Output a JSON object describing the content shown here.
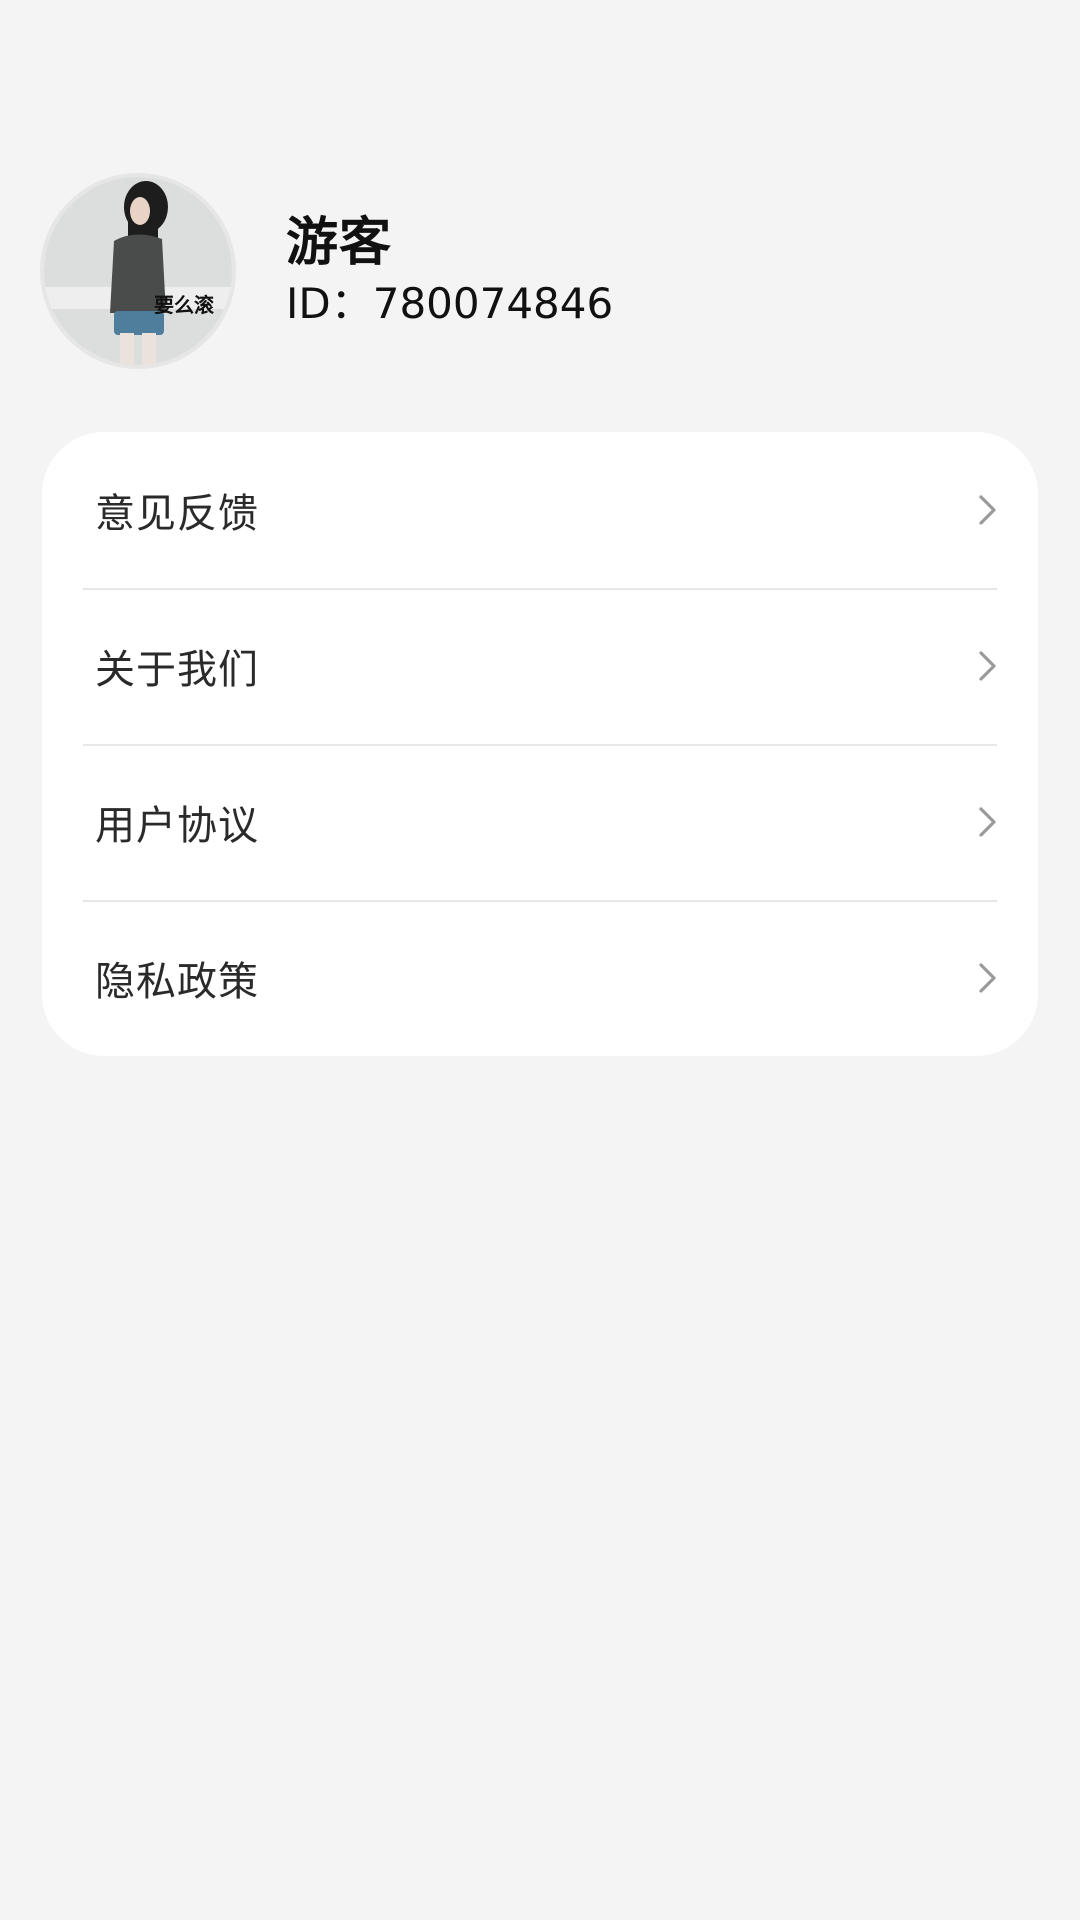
{
  "profile": {
    "avatar_caption": "要么滚",
    "username": "游客",
    "user_id": "ID：780074846"
  },
  "menu": {
    "items": [
      {
        "label": "意见反馈",
        "icon": "chevron-right-icon"
      },
      {
        "label": "关于我们",
        "icon": "chevron-right-icon"
      },
      {
        "label": "用户协议",
        "icon": "chevron-right-icon"
      },
      {
        "label": "隐私政策",
        "icon": "chevron-right-icon"
      }
    ]
  },
  "colors": {
    "background": "#f4f4f4",
    "card": "#ffffff",
    "divider": "#e7e7e7",
    "chevron": "#9a9a9a",
    "text_primary": "#111111"
  }
}
